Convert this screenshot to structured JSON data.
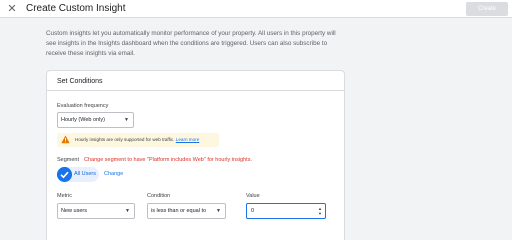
{
  "header": {
    "title": "Create Custom Insight",
    "create_label": "Create"
  },
  "description": "Custom insights let you automatically monitor performance of your property. All users in this property will see insights in the Insights dashboard when the conditions are triggered. Users can also subscribe to receive these insights via email.",
  "card": {
    "title": "Set Conditions"
  },
  "evaluation": {
    "label": "Evaluation frequency",
    "value": "Hourly (Web only)"
  },
  "warning": {
    "text": "Hourly insights are only supported for web traffic.",
    "link": "Learn more"
  },
  "segment": {
    "label": "Segment",
    "warning": "Change segment to have \"Platform includes Web\" for hourly insights.",
    "chip_label": "All Users",
    "change_label": "Change"
  },
  "metric": {
    "label": "Metric",
    "value": "New users"
  },
  "condition": {
    "label": "Condition",
    "value": "is less than or equal to"
  },
  "value_field": {
    "label": "Value",
    "value": "0"
  },
  "colors": {
    "accent": "#1a73e8",
    "warning_bg": "#fef7e0",
    "error_text": "#d93025"
  },
  "icons": {
    "close": "close-icon",
    "warning": "warning-icon",
    "check": "check-icon"
  }
}
